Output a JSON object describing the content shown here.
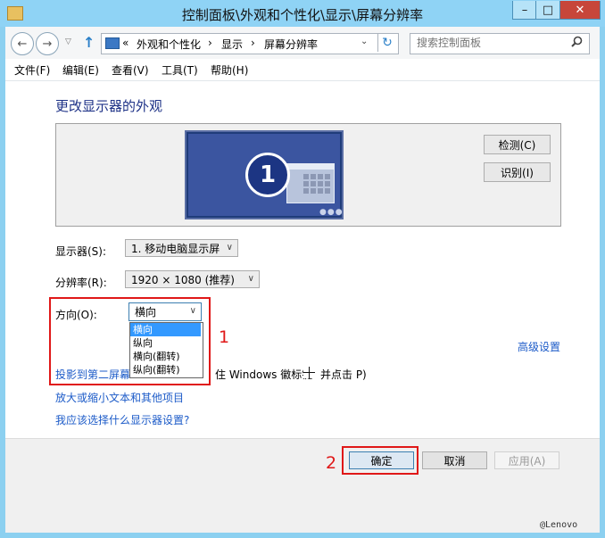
{
  "window": {
    "title": "控制面板\\外观和个性化\\显示\\屏幕分辨率",
    "min_glyph": "–",
    "max_glyph": "□",
    "close_glyph": "✕"
  },
  "address": {
    "prefix": "«",
    "crumbs": [
      "外观和个性化",
      "显示",
      "屏幕分辨率"
    ],
    "sep": "›",
    "dropdown_glyph": "⌄",
    "refresh_glyph": "↻"
  },
  "search": {
    "placeholder": "搜索控制面板",
    "icon": "search-icon"
  },
  "nav": {
    "back": "←",
    "forward": "→",
    "recent": "▽",
    "up": "↑"
  },
  "menu": [
    "文件(F)",
    "编辑(E)",
    "查看(V)",
    "工具(T)",
    "帮助(H)"
  ],
  "page": {
    "title": "更改显示器的外观",
    "monitor_number": "1",
    "detect": "检测(C)",
    "identify": "识别(I)"
  },
  "fields": {
    "display_label": "显示器(S):",
    "display_value": "1. 移动电脑显示屏",
    "resolution_label": "分辨率(R):",
    "resolution_value": "1920 × 1080 (推荐)",
    "orientation_label": "方向(O):",
    "orientation_value": "横向",
    "orientation_options": [
      "横向",
      "纵向",
      "横向(翻转)",
      "纵向(翻转)"
    ]
  },
  "links": {
    "advanced": "高级设置",
    "project_prefix": "投影到第二屏幕",
    "project_tail": "住 Windows 徽标键",
    "project_tail2": "并点击 P)",
    "zoom": "放大或缩小文本和其他项目",
    "which": "我应该选择什么显示器设置?"
  },
  "footer": {
    "ok": "确定",
    "cancel": "取消",
    "apply": "应用(A)"
  },
  "annotations": {
    "callout_1": "1",
    "callout_2": "2",
    "accent": "#e01818"
  },
  "watermark": "@Lenovo"
}
